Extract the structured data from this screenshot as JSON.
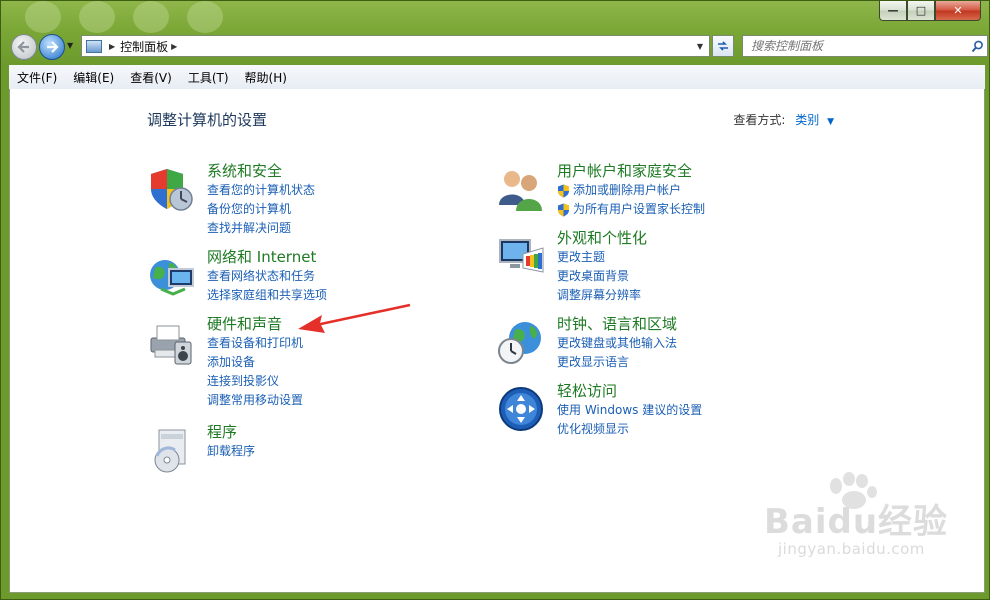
{
  "window": {
    "caption_buttons": {
      "minimize": "—",
      "maximize": "□",
      "close": "✕"
    }
  },
  "nav": {
    "back_icon": "back-arrow-icon",
    "forward_icon": "forward-arrow-icon",
    "address_path": [
      "控制面板"
    ],
    "search_placeholder": "搜索控制面板"
  },
  "menu": [
    "文件(F)",
    "编辑(E)",
    "查看(V)",
    "工具(T)",
    "帮助(H)"
  ],
  "content": {
    "title": "调整计算机的设置",
    "view_by_label": "查看方式:",
    "view_by_value": "类别"
  },
  "categories": {
    "left": [
      {
        "title": "系统和安全",
        "icon": "shield-icon",
        "links": [
          "查看您的计算机状态",
          "备份您的计算机",
          "查找并解决问题"
        ]
      },
      {
        "title": "网络和 Internet",
        "icon": "network-globe-icon",
        "links": [
          "查看网络状态和任务",
          "选择家庭组和共享选项"
        ]
      },
      {
        "title": "硬件和声音",
        "icon": "printer-icon",
        "links": [
          "查看设备和打印机",
          "添加设备",
          "连接到投影仪",
          "调整常用移动设置"
        ]
      },
      {
        "title": "程序",
        "icon": "programs-disc-icon",
        "links": [
          "卸载程序"
        ]
      }
    ],
    "right": [
      {
        "title": "用户帐户和家庭安全",
        "icon": "users-icon",
        "links": [
          "添加或删除用户帐户",
          "为所有用户设置家长控制"
        ],
        "shield_links": true
      },
      {
        "title": "外观和个性化",
        "icon": "monitor-palette-icon",
        "links": [
          "更改主题",
          "更改桌面背景",
          "调整屏幕分辨率"
        ]
      },
      {
        "title": "时钟、语言和区域",
        "icon": "clock-globe-icon",
        "links": [
          "更改键盘或其他输入法",
          "更改显示语言"
        ]
      },
      {
        "title": "轻松访问",
        "icon": "ease-of-access-icon",
        "links": [
          "使用 Windows 建议的设置",
          "优化视频显示"
        ]
      }
    ]
  },
  "watermark": {
    "main": "Baidu经验",
    "sub": "jingyan.baidu.com"
  },
  "colors": {
    "heading_green": "#1e7a23",
    "link_blue": "#1b5fb5",
    "annotation_red": "#e5302a"
  }
}
